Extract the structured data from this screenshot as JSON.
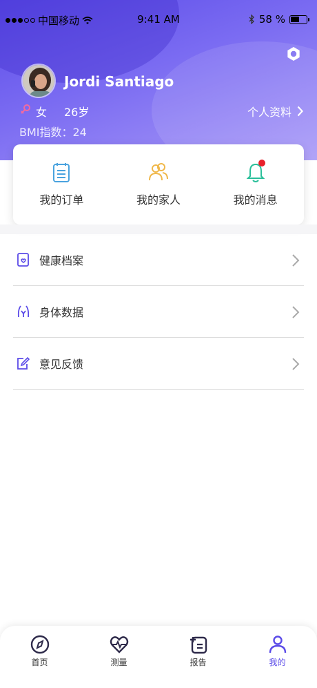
{
  "status_bar": {
    "carrier": "中国移动",
    "time": "9:41 AM",
    "battery_text": "58 %",
    "battery_level": 0.58
  },
  "profile": {
    "name": "Jordi Santiago",
    "gender": "女",
    "age": "26岁",
    "bmi": "BMI指数：24",
    "profile_link": "个人资料"
  },
  "quick_actions": [
    {
      "label": "我的订单",
      "icon": "order-icon"
    },
    {
      "label": "我的家人",
      "icon": "family-icon"
    },
    {
      "label": "我的消息",
      "icon": "bell-icon"
    }
  ],
  "menu": [
    {
      "label": "健康档案",
      "icon": "health-record-icon"
    },
    {
      "label": "身体数据",
      "icon": "body-data-icon"
    },
    {
      "label": "意见反馈",
      "icon": "feedback-icon"
    }
  ],
  "tabs": [
    {
      "label": "首页",
      "icon": "compass-icon"
    },
    {
      "label": "测量",
      "icon": "heart-pulse-icon"
    },
    {
      "label": "报告",
      "icon": "report-icon"
    },
    {
      "label": "我的",
      "icon": "person-icon"
    }
  ],
  "colors": {
    "accent": "#5b4be8",
    "badge": "#e8202a",
    "order_icon": "#4aa3df",
    "family_icon": "#f0b84a",
    "bell_icon": "#2bbf9a"
  }
}
